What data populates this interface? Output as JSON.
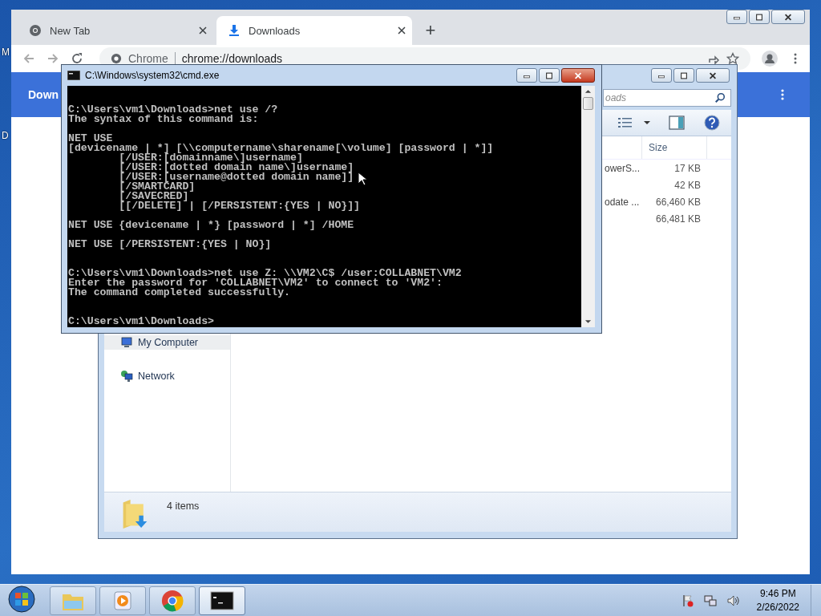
{
  "desktop": {
    "icon_labels": [
      "M",
      "D"
    ]
  },
  "browser": {
    "tabs": [
      {
        "label": "New Tab",
        "kind": "newtab",
        "selected": false
      },
      {
        "label": "Downloads",
        "kind": "downloads",
        "selected": true
      }
    ],
    "new_tab_button": "+",
    "omnibox": {
      "site_label": "Chrome",
      "url": "chrome://downloads"
    },
    "page": {
      "title": "Down"
    }
  },
  "explorer": {
    "search": {
      "placeholder": "oads"
    },
    "columns": [
      "Size"
    ],
    "rows": [
      {
        "name": "owerS...",
        "size": "17 KB"
      },
      {
        "size": "42 KB"
      },
      {
        "name": "odate ...",
        "size": "66,460 KB"
      },
      {
        "size": "66,481 KB"
      }
    ],
    "nav_items": [
      {
        "label": "My Computer",
        "kind": "computer",
        "selected": true
      },
      {
        "label": "Network",
        "kind": "network",
        "selected": false
      }
    ],
    "status": "4 items"
  },
  "console": {
    "title": "C:\\Windows\\system32\\cmd.exe",
    "output": "C:\\Users\\vm1\\Downloads>net use /?\nThe syntax of this command is:\n\nNET USE\n[devicename | *] [\\\\computername\\sharename[\\volume] [password | *]]\n        [/USER:[domainname\\]username]\n        [/USER:[dotted domain name\\]username]\n        [/USER:[username@dotted domain name]]\n        [/SMARTCARD]\n        [/SAVECRED]\n        [[/DELETE] | [/PERSISTENT:{YES | NO}]]\n\nNET USE {devicename | *} [password | *] /HOME\n\nNET USE [/PERSISTENT:{YES | NO}]\n\n\nC:\\Users\\vm1\\Downloads>net use Z: \\\\VM2\\C$ /user:COLLABNET\\VM2\nEnter the password for 'COLLABNET\\VM2' to connect to 'VM2':\nThe command completed successfully.\n\n\nC:\\Users\\vm1\\Downloads>"
  },
  "taskbar": {
    "items": [
      {
        "kind": "explorer",
        "selected": false
      },
      {
        "kind": "media",
        "selected": false
      },
      {
        "kind": "browser",
        "selected": false
      },
      {
        "kind": "cmd",
        "selected": true
      }
    ],
    "clock": {
      "time": "9:46 PM",
      "date": "2/26/2022"
    }
  }
}
